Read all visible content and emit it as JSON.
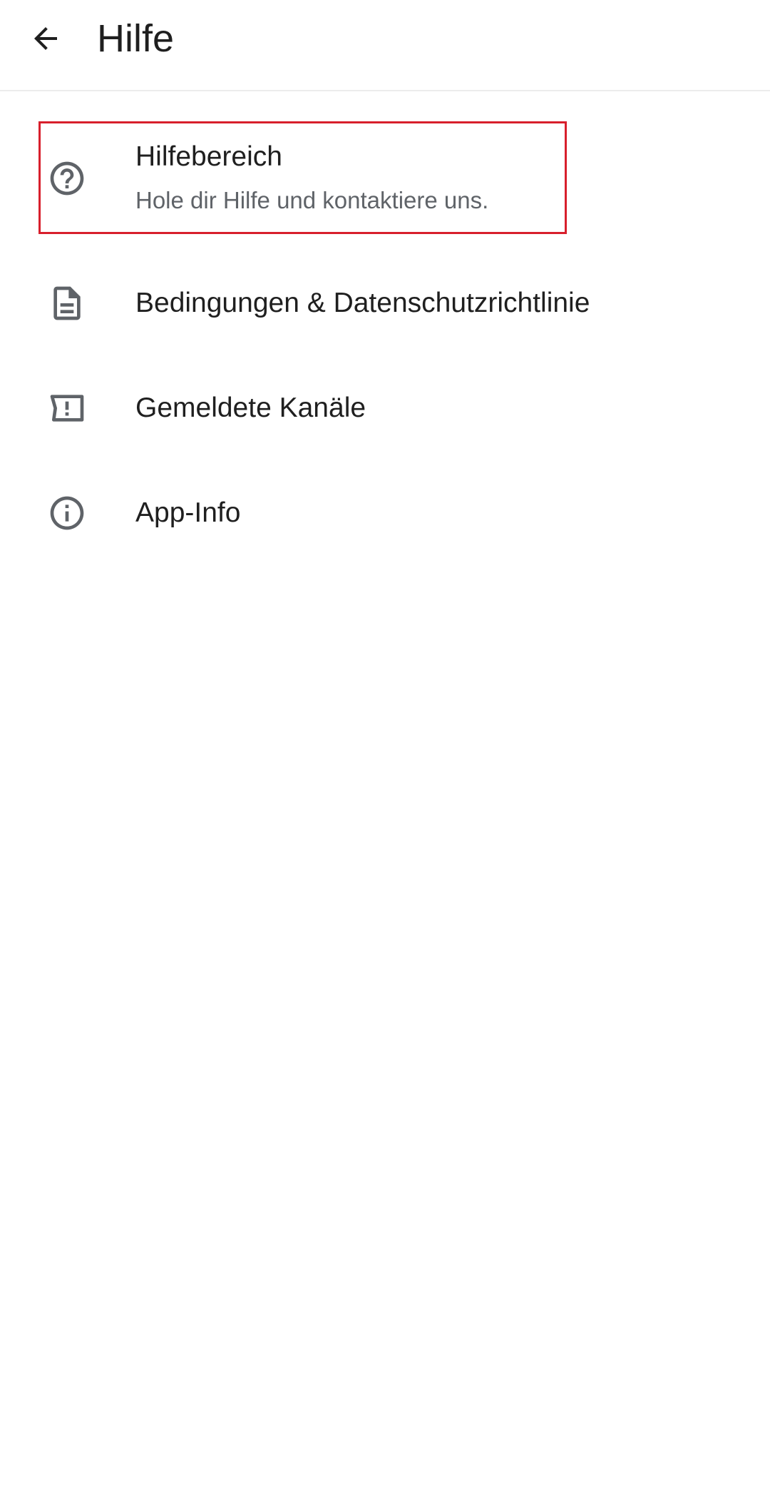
{
  "header": {
    "title": "Hilfe",
    "back_icon": "arrow-left-icon"
  },
  "menu": {
    "items": [
      {
        "id": "help-center",
        "icon": "help-circle-icon",
        "label": "Hilfebereich",
        "sublabel": "Hole dir Hilfe und kontaktiere uns."
      },
      {
        "id": "terms",
        "icon": "document-icon",
        "label": "Bedingungen & Datenschutzrichtlinie"
      },
      {
        "id": "reported-channels",
        "icon": "report-flag-icon",
        "label": "Gemeldete Kanäle"
      },
      {
        "id": "app-info",
        "icon": "info-icon",
        "label": "App-Info"
      }
    ]
  },
  "colors": {
    "highlight": "#d81f2c",
    "icon": "#5f6368",
    "text": "#1f1f1f"
  }
}
